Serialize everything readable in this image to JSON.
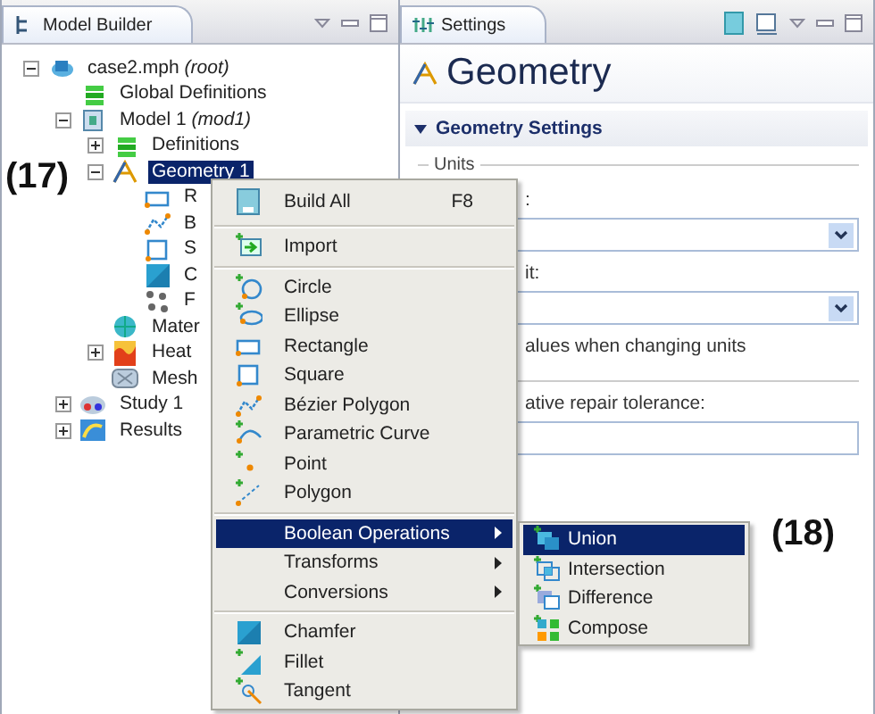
{
  "model_builder": {
    "title": "Model Builder",
    "tree": [
      {
        "label": "case2.mph",
        "tag": "(root)",
        "kind": "root",
        "expanded": true,
        "selected": false,
        "children": [
          {
            "label": "Global Definitions",
            "kind": "definitions",
            "selected": false
          },
          {
            "label": "Model 1",
            "tag": "(mod1)",
            "kind": "model",
            "expanded": true,
            "selected": false,
            "children": [
              {
                "label": "Definitions",
                "kind": "definitions",
                "expanded": false,
                "selected": false
              },
              {
                "label": "Geometry 1",
                "kind": "geometry",
                "expanded": true,
                "selected": true,
                "children": [
                  {
                    "label": "R",
                    "kind": "rectangle",
                    "selected": false
                  },
                  {
                    "label": "B",
                    "kind": "bezier",
                    "selected": false
                  },
                  {
                    "label": "S",
                    "kind": "square",
                    "selected": false
                  },
                  {
                    "label": "C",
                    "kind": "chamfer",
                    "selected": false
                  },
                  {
                    "label": "F",
                    "kind": "form",
                    "selected": false
                  }
                ]
              },
              {
                "label": "Mater",
                "kind": "materials",
                "selected": false
              },
              {
                "label": "Heat",
                "kind": "heat",
                "expanded": false,
                "selected": false
              },
              {
                "label": "Mesh",
                "kind": "mesh",
                "selected": false
              }
            ]
          },
          {
            "label": "Study 1",
            "kind": "study",
            "expanded": false,
            "selected": false
          },
          {
            "label": "Results",
            "kind": "results",
            "expanded": false,
            "selected": false
          }
        ]
      }
    ]
  },
  "settings": {
    "title": "Settings",
    "heading": "Geometry",
    "section": {
      "title": "Geometry Settings",
      "expanded": true
    },
    "group": "Units",
    "rows": [
      {
        "kind": "label",
        "text": ":"
      },
      {
        "kind": "select"
      },
      {
        "kind": "label",
        "text": "it:"
      },
      {
        "kind": "select"
      },
      {
        "kind": "label",
        "text": "alues when changing units"
      },
      {
        "kind": "separator"
      },
      {
        "kind": "label",
        "text": "ative repair tolerance:"
      },
      {
        "kind": "input"
      }
    ]
  },
  "context_menu": {
    "groups": [
      [
        {
          "label": "Build All",
          "shortcut": "F8",
          "kind": "build",
          "submenu": false,
          "selected": false
        }
      ],
      [
        {
          "label": "Import",
          "kind": "import",
          "submenu": false,
          "selected": false
        }
      ],
      [
        {
          "label": "Circle",
          "kind": "circle",
          "submenu": false,
          "selected": false
        },
        {
          "label": "Ellipse",
          "kind": "ellipse",
          "submenu": false,
          "selected": false
        },
        {
          "label": "Rectangle",
          "kind": "rectangle",
          "submenu": false,
          "selected": false
        },
        {
          "label": "Square",
          "kind": "square",
          "submenu": false,
          "selected": false
        },
        {
          "label": "Bézier Polygon",
          "kind": "bezier",
          "submenu": false,
          "selected": false
        },
        {
          "label": "Parametric Curve",
          "kind": "curve",
          "submenu": false,
          "selected": false
        },
        {
          "label": "Point",
          "kind": "point",
          "submenu": false,
          "selected": false
        },
        {
          "label": "Polygon",
          "kind": "polygon",
          "submenu": false,
          "selected": false
        }
      ],
      [
        {
          "label": "Boolean Operations",
          "kind": "none",
          "submenu": true,
          "selected": true
        },
        {
          "label": "Transforms",
          "kind": "none",
          "submenu": true,
          "selected": false
        },
        {
          "label": "Conversions",
          "kind": "none",
          "submenu": true,
          "selected": false
        }
      ],
      [
        {
          "label": "Chamfer",
          "kind": "chamfer",
          "submenu": false,
          "selected": false
        },
        {
          "label": "Fillet",
          "kind": "fillet",
          "submenu": false,
          "selected": false
        },
        {
          "label": "Tangent",
          "kind": "tangent",
          "submenu": false,
          "selected": false
        }
      ]
    ]
  },
  "submenu": {
    "items": [
      {
        "label": "Union",
        "kind": "union",
        "selected": true
      },
      {
        "label": "Intersection",
        "kind": "intersection",
        "selected": false
      },
      {
        "label": "Difference",
        "kind": "difference",
        "selected": false
      },
      {
        "label": "Compose",
        "kind": "compose",
        "selected": false
      }
    ]
  },
  "callouts": [
    {
      "text": "(17)"
    },
    {
      "text": "(18)"
    }
  ]
}
